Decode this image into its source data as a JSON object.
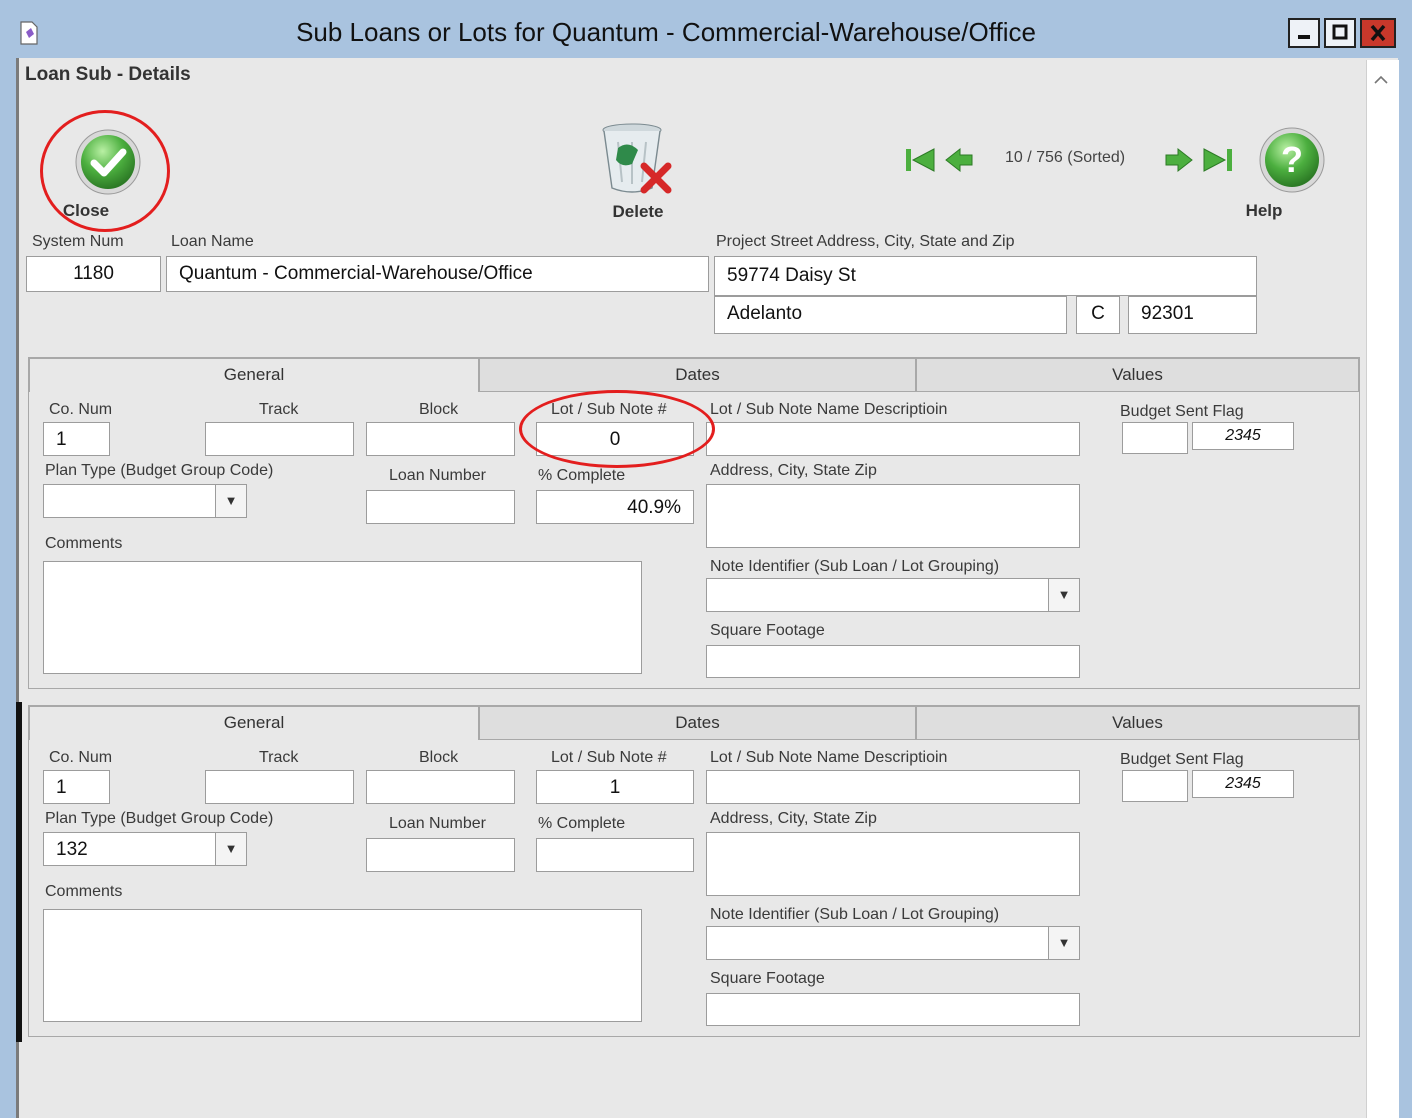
{
  "window": {
    "title": "Sub Loans or Lots for Quantum - Commercial-Warehouse/Office",
    "icon": "app-icon"
  },
  "header": {
    "section_title": "Loan Sub - Details",
    "close_label": "Close",
    "delete_label": "Delete",
    "help_label": "Help",
    "record_position": "10 / 756 (Sorted)"
  },
  "loan": {
    "system_num_label": "System Num",
    "system_num": "1180",
    "loan_name_label": "Loan Name",
    "loan_name": "Quantum - Commercial-Warehouse/Office",
    "address_label": "Project Street Address, City, State and Zip",
    "street": "59774 Daisy St",
    "city": "Adelanto",
    "state": "C",
    "zip": "92301"
  },
  "labels": {
    "co_num": "Co. Num",
    "track": "Track",
    "block": "Block",
    "lot_sub_note": "Lot / Sub Note #",
    "lot_name_desc": "Lot / Sub Note Name Descriptioin",
    "budget_sent_flag": "Budget Sent Flag",
    "plan_type": "Plan Type (Budget Group Code)",
    "loan_number": "Loan Number",
    "pct_complete": "% Complete",
    "address_city_state_zip": "Address, City, State Zip",
    "comments": "Comments",
    "note_identifier": "Note Identifier (Sub Loan / Lot Grouping)",
    "square_footage": "Square Footage"
  },
  "tabs": [
    "General",
    "Dates",
    "Values"
  ],
  "records": [
    {
      "co_num": "1",
      "track": "",
      "block": "",
      "lot_sub_note": "0",
      "lot_name_desc": "",
      "budget_sent_flag": "",
      "budget_code": "2345",
      "plan_type": "",
      "loan_number": "",
      "pct_complete": "40.9%",
      "address": "",
      "comments": "",
      "note_identifier": "",
      "square_footage": ""
    },
    {
      "co_num": "1",
      "track": "",
      "block": "",
      "lot_sub_note": "1",
      "lot_name_desc": "",
      "budget_sent_flag": "",
      "budget_code": "2345",
      "plan_type": "132",
      "loan_number": "",
      "pct_complete": "",
      "address": "",
      "comments": "",
      "note_identifier": "",
      "square_footage": ""
    }
  ],
  "colors": {
    "titlebar": "#a9c3df",
    "client_bg": "#e8e8e8",
    "annotation_red": "#e31e1e",
    "close_green": "#4caf3f"
  }
}
